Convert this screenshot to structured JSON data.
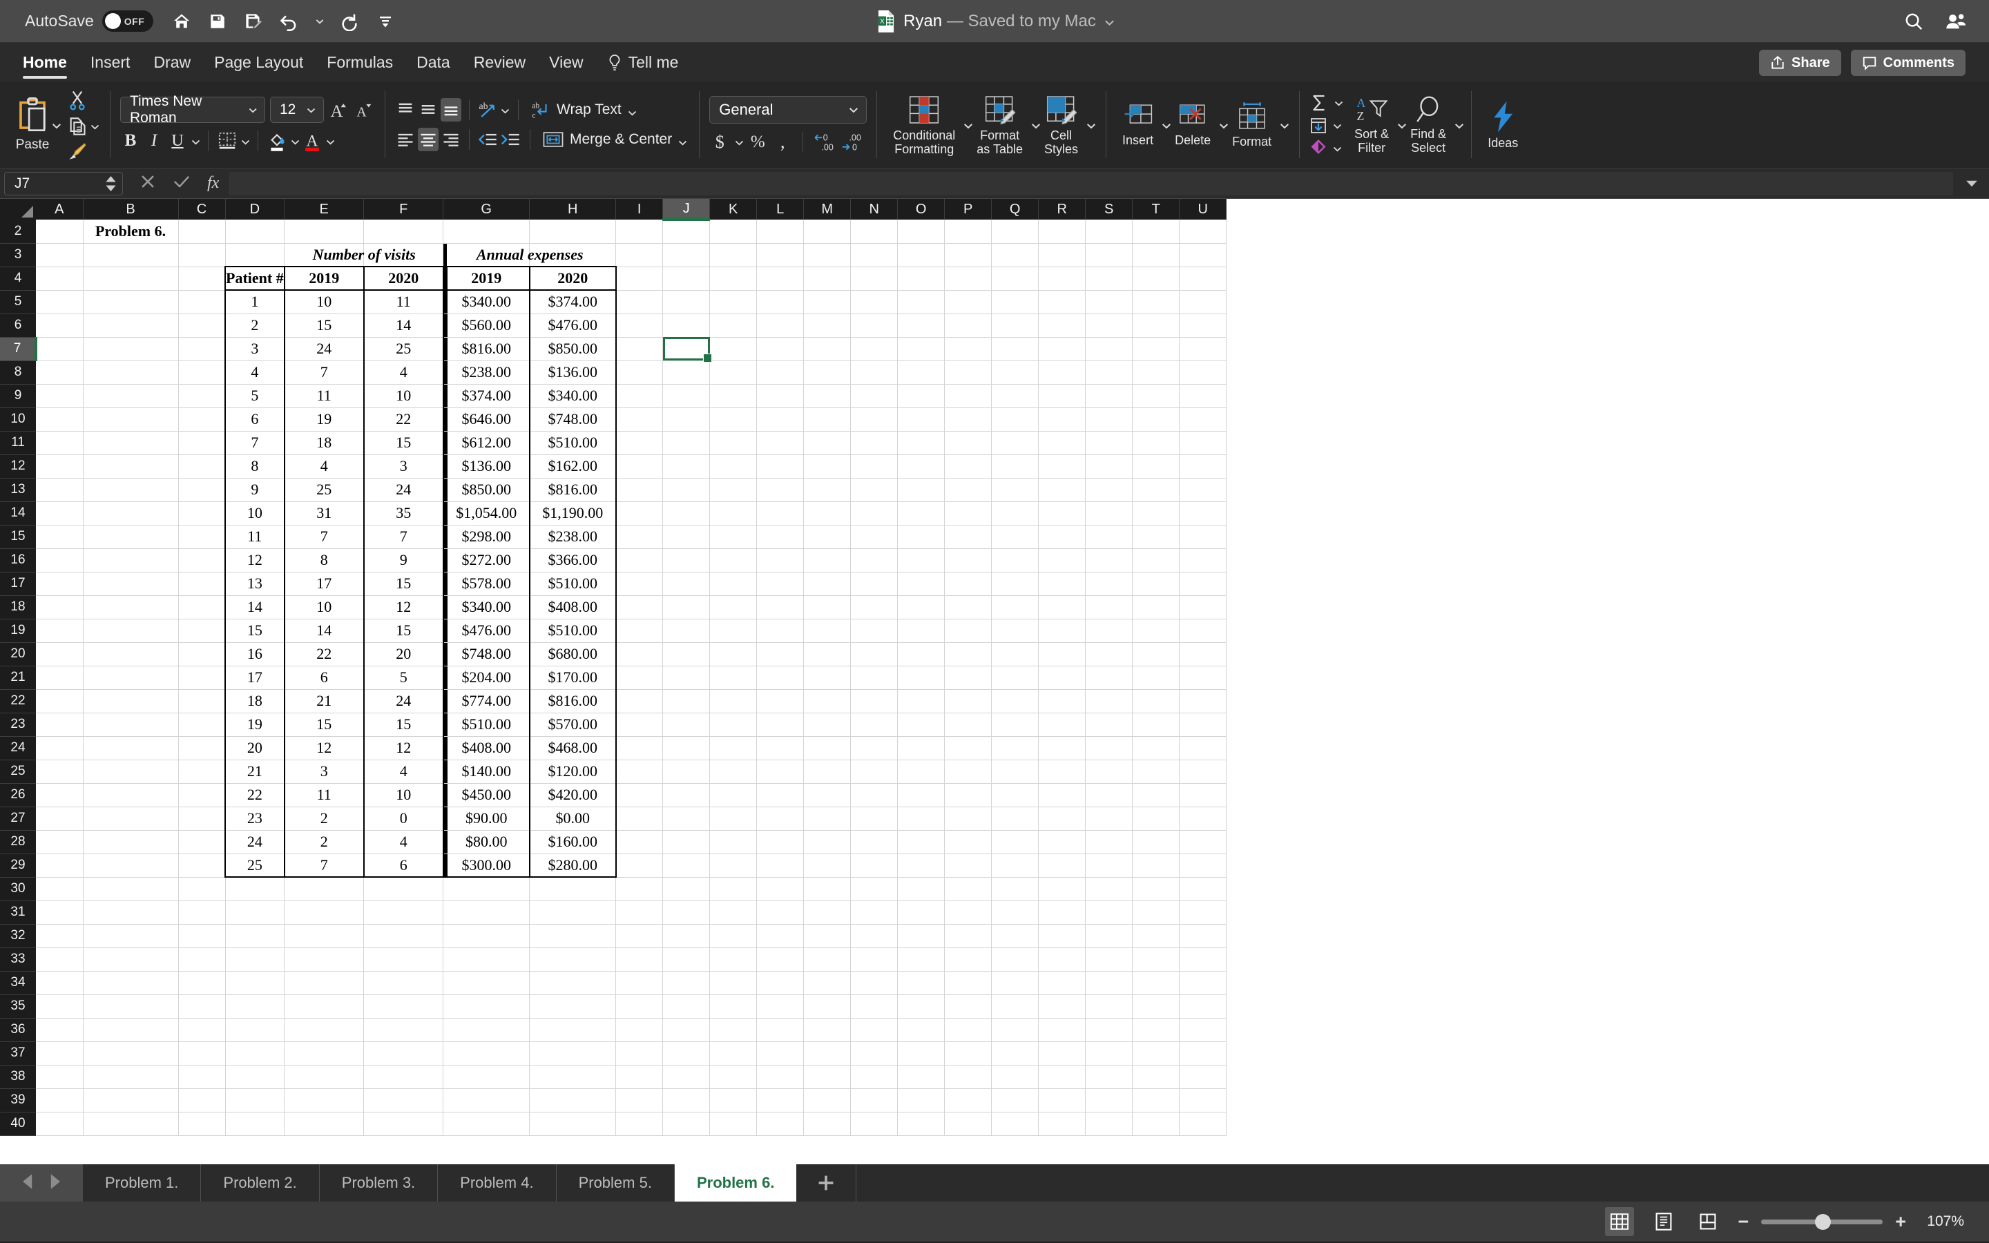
{
  "titlebar": {
    "autosave_label": "AutoSave",
    "autosave_state": "OFF",
    "doc_name": "Ryan",
    "doc_status": "— Saved to my Mac",
    "quick_access": [
      "home-icon",
      "save-icon",
      "save-as-icon",
      "undo-icon",
      "redo-icon",
      "customize-icon"
    ],
    "search_icon": "search-icon",
    "account_icon": "account-icon"
  },
  "tabs": [
    {
      "label": "Home",
      "active": true
    },
    {
      "label": "Insert",
      "active": false
    },
    {
      "label": "Draw",
      "active": false
    },
    {
      "label": "Page Layout",
      "active": false
    },
    {
      "label": "Formulas",
      "active": false
    },
    {
      "label": "Data",
      "active": false
    },
    {
      "label": "Review",
      "active": false
    },
    {
      "label": "View",
      "active": false
    }
  ],
  "tellme": {
    "label": "Tell me",
    "icon": "lightbulb-icon"
  },
  "header_buttons": {
    "share": "Share",
    "comments": "Comments"
  },
  "ribbon": {
    "paste": {
      "label": "Paste",
      "cut": "cut-icon",
      "copy": "copy-icon",
      "format_painter": "format-painter-icon"
    },
    "font": {
      "name": "Times New Roman",
      "size": "12",
      "grow": "increase-font-size-icon",
      "shrink": "decrease-font-size-icon",
      "bold": "B",
      "italic": "I",
      "underline": "U",
      "borders": "borders-icon",
      "fill": "fill-color-icon",
      "font_color": "font-color-icon"
    },
    "alignment": {
      "wrap_text": "Wrap Text",
      "merge_center": "Merge & Center",
      "orientation": "text-orientation-icon",
      "decrease_indent": "decrease-indent-icon",
      "increase_indent": "increase-indent-icon"
    },
    "number": {
      "format": "General",
      "currency": "$",
      "percent": "%",
      "comma": ",",
      "increase_decimal": "increase-decimal-icon",
      "decrease_decimal": "decrease-decimal-icon"
    },
    "styles": {
      "conditional_formatting": "Conditional\nFormatting",
      "conditional_formatting_l1": "Conditional",
      "conditional_formatting_l2": "Formatting",
      "format_as_table_l1": "Format",
      "format_as_table_l2": "as Table",
      "cell_styles_l1": "Cell",
      "cell_styles_l2": "Styles"
    },
    "cells": {
      "insert": "Insert",
      "delete": "Delete",
      "format": "Format"
    },
    "editing": {
      "autosum": "autosum-icon",
      "fill": "fill-down-icon",
      "clear": "clear-icon",
      "sort_filter_l1": "Sort &",
      "sort_filter_l2": "Filter",
      "find_select_l1": "Find &",
      "find_select_l2": "Select"
    },
    "ideas": {
      "label": "Ideas",
      "icon": "ideas-icon"
    }
  },
  "formula_bar": {
    "name_box": "J7",
    "cancel_icon": "cancel-icon",
    "enter_icon": "confirm-icon",
    "fx_icon": "fx",
    "formula_value": "",
    "expand_icon": "expand-formula-bar-icon"
  },
  "grid": {
    "columns": [
      "A",
      "B",
      "C",
      "D",
      "E",
      "F",
      "G",
      "H",
      "I",
      "J",
      "K",
      "L",
      "M",
      "N",
      "O",
      "P",
      "Q",
      "R",
      "S",
      "T",
      "U"
    ],
    "selected_cell": "J7",
    "selected_column": "J",
    "selected_row": "7",
    "rows": [
      "2",
      "3",
      "4",
      "5",
      "6",
      "7",
      "8",
      "9",
      "10",
      "11",
      "12",
      "13",
      "14",
      "15",
      "16",
      "17",
      "18",
      "19",
      "20",
      "21",
      "22",
      "23",
      "24",
      "25",
      "26",
      "27",
      "28",
      "29",
      "30",
      "31",
      "32",
      "33",
      "34",
      "35",
      "36",
      "37",
      "38",
      "39",
      "40"
    ],
    "problem_label": "Problem 6.",
    "group_header_visits": "Number of visits",
    "group_header_expenses": "Annual expenses",
    "col_headers": {
      "patient": "Patient #",
      "visits_2019": "2019",
      "visits_2020": "2020",
      "expenses_2019": "2019",
      "expenses_2020": "2020"
    }
  },
  "chart_data": {
    "type": "table",
    "title": "Problem 6.",
    "column_groups": [
      {
        "label": "Number of visits",
        "columns": [
          "2019",
          "2020"
        ]
      },
      {
        "label": "Annual expenses",
        "columns": [
          "2019",
          "2020"
        ]
      }
    ],
    "columns": [
      "Patient #",
      "2019",
      "2020",
      "2019",
      "2020"
    ],
    "rows": [
      [
        "1",
        "10",
        "11",
        "$340.00",
        "$374.00"
      ],
      [
        "2",
        "15",
        "14",
        "$560.00",
        "$476.00"
      ],
      [
        "3",
        "24",
        "25",
        "$816.00",
        "$850.00"
      ],
      [
        "4",
        "7",
        "4",
        "$238.00",
        "$136.00"
      ],
      [
        "5",
        "11",
        "10",
        "$374.00",
        "$340.00"
      ],
      [
        "6",
        "19",
        "22",
        "$646.00",
        "$748.00"
      ],
      [
        "7",
        "18",
        "15",
        "$612.00",
        "$510.00"
      ],
      [
        "8",
        "4",
        "3",
        "$136.00",
        "$162.00"
      ],
      [
        "9",
        "25",
        "24",
        "$850.00",
        "$816.00"
      ],
      [
        "10",
        "31",
        "35",
        "$1,054.00",
        "$1,190.00"
      ],
      [
        "11",
        "7",
        "7",
        "$298.00",
        "$238.00"
      ],
      [
        "12",
        "8",
        "9",
        "$272.00",
        "$366.00"
      ],
      [
        "13",
        "17",
        "15",
        "$578.00",
        "$510.00"
      ],
      [
        "14",
        "10",
        "12",
        "$340.00",
        "$408.00"
      ],
      [
        "15",
        "14",
        "15",
        "$476.00",
        "$510.00"
      ],
      [
        "16",
        "22",
        "20",
        "$748.00",
        "$680.00"
      ],
      [
        "17",
        "6",
        "5",
        "$204.00",
        "$170.00"
      ],
      [
        "18",
        "21",
        "24",
        "$774.00",
        "$816.00"
      ],
      [
        "19",
        "15",
        "15",
        "$510.00",
        "$570.00"
      ],
      [
        "20",
        "12",
        "12",
        "$408.00",
        "$468.00"
      ],
      [
        "21",
        "3",
        "4",
        "$140.00",
        "$120.00"
      ],
      [
        "22",
        "11",
        "10",
        "$450.00",
        "$420.00"
      ],
      [
        "23",
        "2",
        "0",
        "$90.00",
        "$0.00"
      ],
      [
        "24",
        "2",
        "4",
        "$80.00",
        "$160.00"
      ],
      [
        "25",
        "7",
        "6",
        "$300.00",
        "$280.00"
      ]
    ]
  },
  "sheet_tabs": [
    {
      "label": "Problem 1.",
      "active": false
    },
    {
      "label": "Problem 2.",
      "active": false
    },
    {
      "label": "Problem 3.",
      "active": false
    },
    {
      "label": "Problem 4.",
      "active": false
    },
    {
      "label": "Problem 5.",
      "active": false
    },
    {
      "label": "Problem 6.",
      "active": true
    }
  ],
  "add_sheet": "+",
  "status_bar": {
    "normal_view": "normal-view-icon",
    "page_layout_view": "page-layout-view-icon",
    "page_break_view": "page-break-view-icon",
    "zoom_out": "−",
    "zoom_in": "+",
    "zoom_level": "107%"
  },
  "colors": {
    "accent_green": "#217346",
    "titlebar_bg": "#4a4a4a",
    "ribbon_bg": "#262626"
  }
}
